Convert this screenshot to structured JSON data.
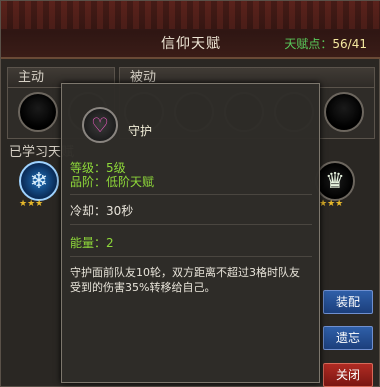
{
  "header": {
    "title": "信仰天赋",
    "points_label": "天赋点：",
    "points_value": "56/41"
  },
  "panels": {
    "active_label": "主动",
    "passive_label": "被动",
    "learned_label": "已学习天赋"
  },
  "learned": [
    {
      "icon": "snowflake-icon",
      "stars": "★★★"
    },
    {
      "icon": "crown-icon",
      "stars": "★★★"
    }
  ],
  "popup": {
    "skill_name": "守护",
    "icon": "heart-ring-icon",
    "level": "等级：5级",
    "grade": "品阶：低阶天赋",
    "cooldown": "冷却：30秒",
    "energy": "能量：2",
    "description_1": "守护面前队友10轮，双方距离不超过3格时队友",
    "description_2": "受到的伤害35%转移给自己。"
  },
  "buttons": {
    "equip": "装配",
    "forget": "遗忘",
    "close": "关闭"
  },
  "colors": {
    "accent_green": "#8ed83a",
    "button_blue": "#1c3f7c",
    "button_red": "#7a1612",
    "star_gold": "#e8b92b"
  }
}
